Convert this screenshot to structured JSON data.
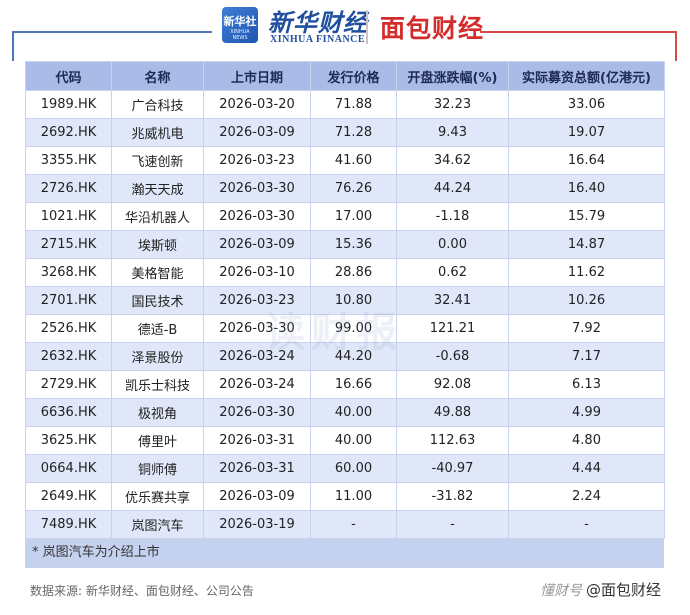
{
  "header": {
    "badge_cn": "新华社",
    "badge_en": "XINHUA NEWS",
    "xinhua_title": "新华财经",
    "xinhua_sub": "XINHUA FINANCE",
    "mianbao_logo": "面包财经"
  },
  "table": {
    "headers": [
      "代码",
      "名称",
      "上市日期",
      "发行价格",
      "开盘涨跌幅(%)",
      "实际募资总额(亿港元)"
    ],
    "rows": [
      [
        "1989.HK",
        "广合科技",
        "2026-03-20",
        "71.88",
        "32.23",
        "33.06"
      ],
      [
        "2692.HK",
        "兆威机电",
        "2026-03-09",
        "71.28",
        "9.43",
        "19.07"
      ],
      [
        "3355.HK",
        "飞速创新",
        "2026-03-23",
        "41.60",
        "34.62",
        "16.64"
      ],
      [
        "2726.HK",
        "瀚天天成",
        "2026-03-30",
        "76.26",
        "44.24",
        "16.40"
      ],
      [
        "1021.HK",
        "华沿机器人",
        "2026-03-30",
        "17.00",
        "-1.18",
        "15.79"
      ],
      [
        "2715.HK",
        "埃斯顿",
        "2026-03-09",
        "15.36",
        "0.00",
        "14.87"
      ],
      [
        "3268.HK",
        "美格智能",
        "2026-03-10",
        "28.86",
        "0.62",
        "11.62"
      ],
      [
        "2701.HK",
        "国民技术",
        "2026-03-23",
        "10.80",
        "32.41",
        "10.26"
      ],
      [
        "2526.HK",
        "德适-B",
        "2026-03-30",
        "99.00",
        "121.21",
        "7.92"
      ],
      [
        "2632.HK",
        "泽景股份",
        "2026-03-24",
        "44.20",
        "-0.68",
        "7.17"
      ],
      [
        "2729.HK",
        "凯乐士科技",
        "2026-03-24",
        "16.66",
        "92.08",
        "6.13"
      ],
      [
        "6636.HK",
        "极视角",
        "2026-03-30",
        "40.00",
        "49.88",
        "4.99"
      ],
      [
        "3625.HK",
        "傅里叶",
        "2026-03-31",
        "40.00",
        "112.63",
        "4.80"
      ],
      [
        "0664.HK",
        "铜师傅",
        "2026-03-31",
        "60.00",
        "-40.97",
        "4.44"
      ],
      [
        "2649.HK",
        "优乐赛共享",
        "2026-03-09",
        "11.00",
        "-31.82",
        "2.24"
      ],
      [
        "7489.HK",
        "岚图汽车",
        "2026-03-19",
        "-",
        "-",
        "-"
      ]
    ],
    "note": "* 岚图汽车为介绍上市"
  },
  "watermark": "读财报",
  "footer": {
    "source": "数据来源: 新华财经、面包财经、公司公告",
    "corner_watermark": "懂财号",
    "corner_text": "@面包财经"
  }
}
